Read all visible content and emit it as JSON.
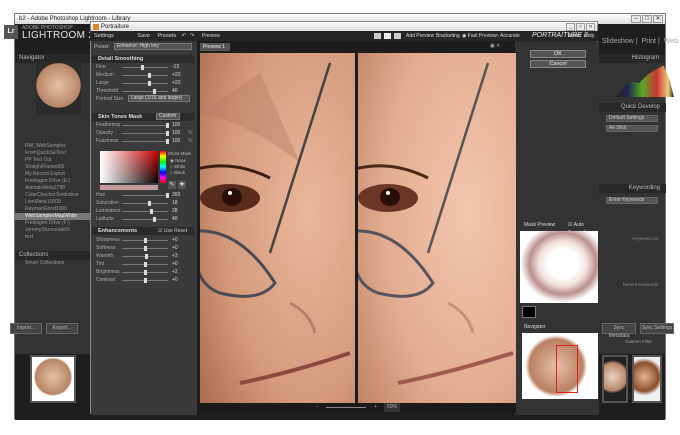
{
  "lightroom": {
    "window_title": "b2 - Adobe Photoshop Lightroom - Library",
    "brand_small": "ADOBE PHOTOSHOP",
    "brand": "LIGHTROOM 2",
    "modules": [
      "Slideshow",
      "Print",
      "Web"
    ],
    "navigator_label": "Navigator",
    "left_folders": [
      "RW_WebSamples",
      "FromQuickSelTest",
      "PP Test Out",
      "StraightFlamed09",
      "My Recent Export",
      "Freelagen Drive (E:)",
      "AnimalsMeta2788",
      "ColorCheckerTestIndoor",
      "LionMane10009",
      "RaymanGrind1006",
      "WebSamplesMapWhite",
      "Freelagen Drive (F:)",
      "JeremyStornuriak09",
      "test",
      "Collections",
      "Smart Collections"
    ],
    "selected_folder": "WebSamplesMapWhite",
    "left_buttons": [
      "Import...",
      "Export..."
    ],
    "right_panels": {
      "histogram": "Histogram",
      "quick_develop": "Quick Develop",
      "preset_default": "Default Settings",
      "preset_asshot": "As Shot",
      "keywording": "Keywording",
      "keyword_hint": "Enter Keywords",
      "keyword_list_title": "Keyword List",
      "recent_keywords": "Recent Keywords",
      "sync_buttons": [
        "Sync Metadata",
        "Sync Settings"
      ]
    },
    "filter_label": "Custom Filter"
  },
  "portraiture": {
    "title": "Portraiture",
    "toolbar": {
      "settings": "Settings",
      "save": "Save",
      "presets": "Presets"
    },
    "preset_label": "Preset:",
    "preset_value": "Enhance: High key",
    "detail_smoothing": {
      "title": "Detail Smoothing",
      "rows": [
        {
          "label": "Fine",
          "value": "-15"
        },
        {
          "label": "Medium",
          "value": "+20"
        },
        {
          "label": "Large",
          "value": "+20"
        },
        {
          "label": "Threshold",
          "value": "40"
        }
      ],
      "portrait_size_label": "Portrait Size",
      "portrait_size_value": "Large (1/16 and larger)"
    },
    "skin_tones_mask": {
      "title": "Skin Tones Mask",
      "mode": "Custom",
      "rows": [
        {
          "label": "Feathering",
          "value": "100",
          "unit": ""
        },
        {
          "label": "Opacity",
          "value": "100",
          "unit": "%"
        },
        {
          "label": "Fuzziness",
          "value": "100",
          "unit": "%"
        }
      ],
      "show_mask_label": "Show Mask",
      "mask_options": [
        "None",
        "White",
        "Black"
      ],
      "color_rows": [
        {
          "label": "Hue",
          "value": "360"
        },
        {
          "label": "Saturation",
          "value": "18"
        },
        {
          "label": "Luminance",
          "value": "28"
        },
        {
          "label": "Latitude",
          "value": "40"
        }
      ]
    },
    "enhancements": {
      "title": "Enhancements",
      "use_reset": "Use Reset",
      "rows": [
        {
          "label": "Sharpness",
          "value": "+0"
        },
        {
          "label": "Softness",
          "value": "+0"
        },
        {
          "label": "Warmth",
          "value": "+3"
        },
        {
          "label": "Tint",
          "value": "+0"
        },
        {
          "label": "Brightness",
          "value": "+2"
        },
        {
          "label": "Contrast",
          "value": "+0"
        }
      ]
    },
    "preview_header": "Preview",
    "preview_tab": "Preview 1",
    "topbar": {
      "add_preview": "Add Preview",
      "bracketing": "Bracketing",
      "fast_preview": "Fast Preview",
      "accurate": "Accurate"
    },
    "logo": "PORTRAITURE 2",
    "about": "About",
    "help": "Help",
    "ok": "OK",
    "cancel": "Cancel",
    "mask_preview": "Mask Preview",
    "auto_expand": "Auto Expand",
    "navigator": "Navigator",
    "zoom": "50%"
  }
}
